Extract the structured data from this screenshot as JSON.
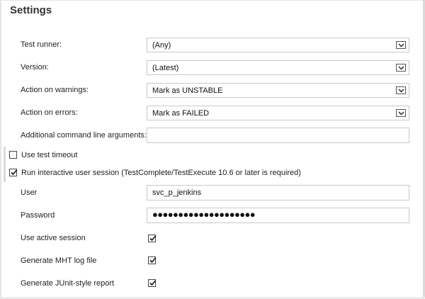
{
  "title": "Settings",
  "fields": {
    "test_runner": {
      "label": "Test runner:",
      "value": "(Any)"
    },
    "version": {
      "label": "Version:",
      "value": "(Latest)"
    },
    "action_warnings": {
      "label": "Action on warnings:",
      "value": "Mark as UNSTABLE"
    },
    "action_errors": {
      "label": "Action on errors:",
      "value": "Mark as FAILED"
    },
    "additional_args": {
      "label": "Additional command line arguments:",
      "value": ""
    }
  },
  "options": {
    "use_test_timeout": {
      "label": "Use test timeout",
      "checked": false
    },
    "interactive_session": {
      "label": "Run interactive user session (TestComplete/TestExecute 10.6 or later is required)",
      "checked": true
    }
  },
  "session": {
    "user": {
      "label": "User",
      "value": "svc_p_jenkins"
    },
    "password": {
      "label": "Password",
      "masked": "●●●●●●●●●●●●●●●●●●●●"
    },
    "use_active_session": {
      "label": "Use active session",
      "checked": true
    },
    "generate_mht": {
      "label": "Generate MHT log file",
      "checked": true
    },
    "generate_junit": {
      "label": "Generate JUnit-style report",
      "checked": true
    }
  },
  "icons": {
    "dropdown": "chevron-down-icon",
    "check": "checkmark-icon"
  }
}
